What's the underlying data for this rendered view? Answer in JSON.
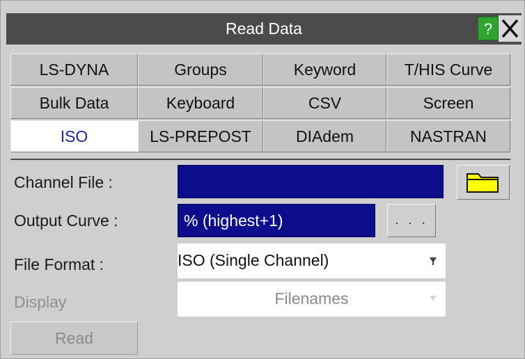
{
  "window": {
    "title": "Read Data",
    "help_label": "?",
    "close_icon": "close-icon",
    "colors": {
      "titlebar": "#4b4b4b",
      "help": "#2fa52f",
      "field": "#0c0d8c",
      "active_tab_text": "#1c25a8"
    }
  },
  "tabs": [
    {
      "label": "LS-DYNA"
    },
    {
      "label": "Groups"
    },
    {
      "label": "Keyword"
    },
    {
      "label": "T/HIS Curve"
    },
    {
      "label": "Bulk Data"
    },
    {
      "label": "Keyboard"
    },
    {
      "label": "CSV"
    },
    {
      "label": "Screen"
    },
    {
      "label": "ISO",
      "active": true
    },
    {
      "label": "LS-PREPOST"
    },
    {
      "label": "DIAdem"
    },
    {
      "label": "NASTRAN"
    }
  ],
  "form": {
    "channel_file_label": "Channel File :",
    "channel_file_value": "",
    "folder_icon": "folder-icon",
    "output_curve_label": "Output Curve :",
    "output_curve_value": "% (highest+1)",
    "output_curve_more": ". . .",
    "file_format_label": "File Format :",
    "file_format_value": "ISO (Single Channel)",
    "display_label": "Display",
    "display_value": "Filenames",
    "read_label": "Read"
  }
}
